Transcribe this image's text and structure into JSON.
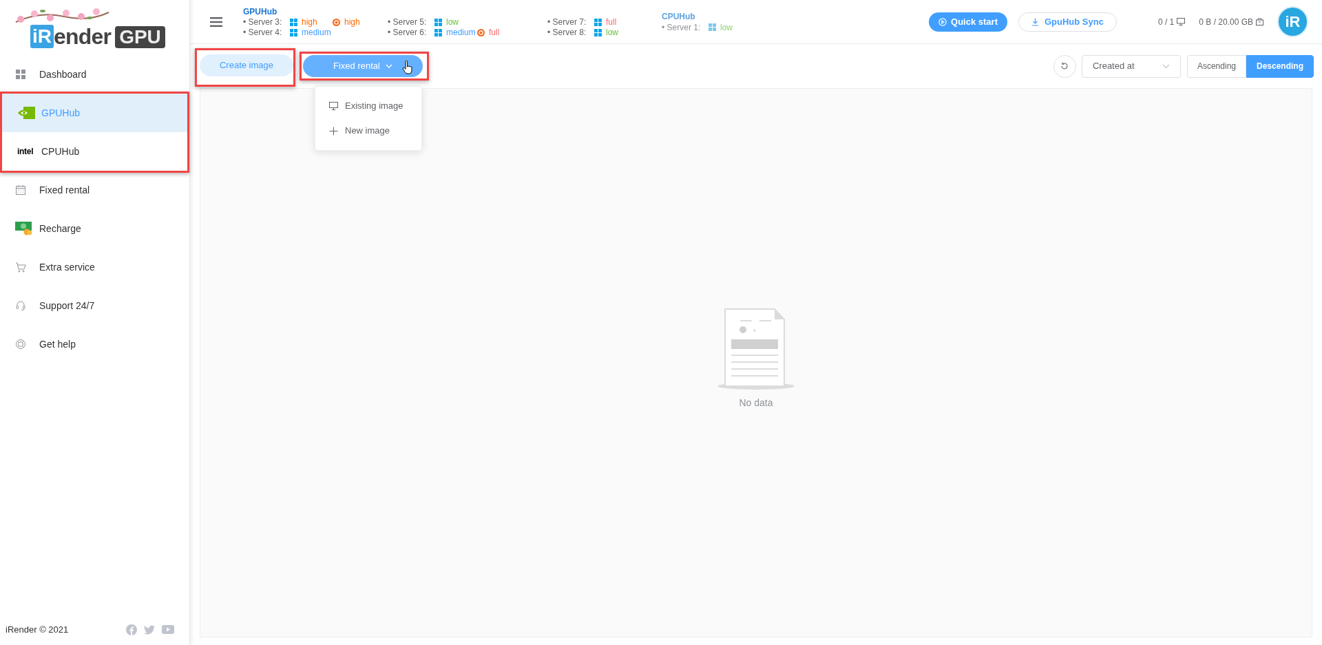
{
  "logo": {
    "mark": "iR",
    "word": "ender",
    "badge": "GPU"
  },
  "sidebar": {
    "items": [
      {
        "kind": "grid",
        "label": "Dashboard",
        "selected": false,
        "highlighted": false
      },
      {
        "kind": "gpu",
        "label": "GPUHub",
        "selected": true,
        "highlighted": true
      },
      {
        "kind": "intel",
        "label": "CPUHub",
        "selected": false,
        "highlighted": true,
        "mark": "intel"
      },
      {
        "kind": "calendar",
        "label": "Fixed rental",
        "selected": false,
        "highlighted": false
      },
      {
        "kind": "money",
        "label": "Recharge",
        "selected": false,
        "highlighted": false
      },
      {
        "kind": "cart",
        "label": "Extra service",
        "selected": false,
        "highlighted": false
      },
      {
        "kind": "headset",
        "label": "Support 24/7",
        "selected": false,
        "highlighted": false
      },
      {
        "kind": "lifebuoy",
        "label": "Get help",
        "selected": false,
        "highlighted": false
      }
    ],
    "footer": "iRender © 2021"
  },
  "header": {
    "hubs": [
      {
        "title": "GPUHub",
        "disabled": false,
        "columns": [
          [
            {
              "name": "• Server 3:",
              "statuses": [
                {
                  "kind": "windows",
                  "label": "high",
                  "color": "#ff6a00"
                },
                {
                  "kind": "ubuntu",
                  "label": "high",
                  "color": "#ff6a00"
                }
              ]
            },
            {
              "name": "• Server 4:",
              "statuses": [
                {
                  "kind": "windows",
                  "label": "medium",
                  "color": "#409eff"
                }
              ]
            }
          ],
          [
            {
              "name": "• Server 5:",
              "statuses": [
                {
                  "kind": "windows",
                  "label": "low",
                  "color": "#67c23a"
                }
              ]
            },
            {
              "name": "• Server 6:",
              "statuses": [
                {
                  "kind": "windows",
                  "label": "medium",
                  "color": "#409eff"
                },
                {
                  "kind": "ubuntu",
                  "label": "full",
                  "color": "#f56c6c"
                }
              ]
            }
          ],
          [
            {
              "name": "• Server 7:",
              "statuses": [
                {
                  "kind": "windows",
                  "label": "full",
                  "color": "#f56c6c"
                }
              ]
            },
            {
              "name": "• Server 8:",
              "statuses": [
                {
                  "kind": "windows",
                  "label": "low",
                  "color": "#67c23a"
                }
              ]
            }
          ]
        ]
      },
      {
        "title": "CPUHub",
        "disabled": true,
        "columns": [
          [
            {
              "name": "• Server 1:",
              "statuses": [
                {
                  "kind": "windows",
                  "label": "low",
                  "color": "#8fd16b"
                }
              ]
            }
          ]
        ]
      }
    ],
    "quick_start": "Quick start",
    "sync": "GpuHub Sync",
    "machines": "0 / 1",
    "storage": "0 B / 20.00 GB",
    "avatar": "iR"
  },
  "toolbar": {
    "create": {
      "label": "Create image",
      "highlighted": true
    },
    "fixed_rental": {
      "label": "Fixed rental",
      "expanded": true,
      "highlighted": true
    },
    "menu": [
      {
        "kind": "monitor",
        "label": "Existing image"
      },
      {
        "kind": "plus",
        "label": "New image"
      }
    ],
    "sort_field": "Created at",
    "order": [
      {
        "label": "Ascending",
        "selected": false
      },
      {
        "label": "Descending",
        "selected": true
      }
    ]
  },
  "empty": "No data"
}
